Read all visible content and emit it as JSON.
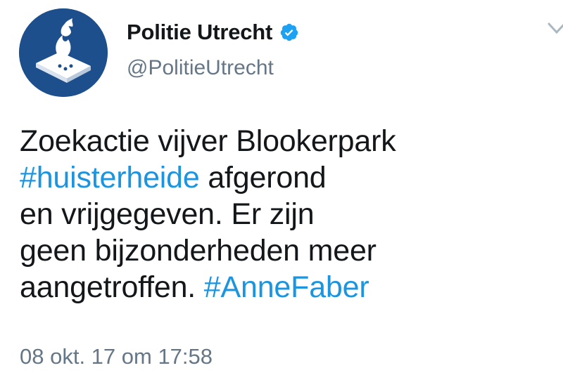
{
  "author": {
    "display_name": "Politie Utrecht",
    "handle": "@PolitieUtrecht",
    "verified": true,
    "avatar_icon": "police-logo-icon",
    "avatar_color": "#1d4f8c"
  },
  "tweet": {
    "lines": [
      [
        {
          "text": "Zoekactie vijver Blookerpark",
          "type": "text"
        }
      ],
      [
        {
          "text": "#huisterheide",
          "type": "hashtag"
        },
        {
          "text": " afgerond",
          "type": "text"
        }
      ],
      [
        {
          "text": "en vrijgegeven. Er zijn",
          "type": "text"
        }
      ],
      [
        {
          "text": "geen bijzonderheden meer",
          "type": "text"
        }
      ],
      [
        {
          "text": "aangetroffen. ",
          "type": "text"
        },
        {
          "text": "#AnneFaber",
          "type": "hashtag"
        }
      ]
    ],
    "timestamp": "08 okt. 17 om 17:58"
  },
  "colors": {
    "text": "#14171a",
    "secondary": "#657786",
    "link": "#1b95e0",
    "verified": "#1da1f2"
  }
}
